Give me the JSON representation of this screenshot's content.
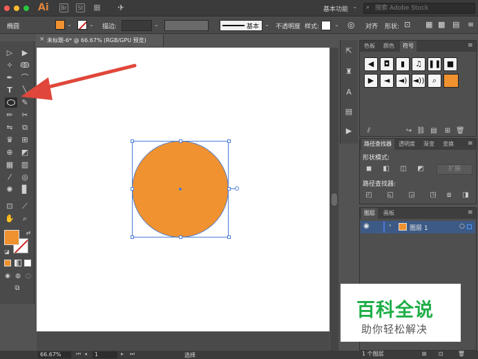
{
  "titlebar": {
    "app_logo": "Ai",
    "bridge_icon": "Br",
    "stock_icon": "St",
    "workspace": "基本功能",
    "search_placeholder": "搜索 Adobe Stock",
    "colors": {
      "close": "#fc5f57",
      "minimize": "#fdbc2e",
      "zoom": "#28c940"
    }
  },
  "controlbar": {
    "object_type": "椭圆",
    "stroke_label": "描边:",
    "brush_preset": "基本",
    "opacity_label": "不透明度",
    "style_label": "样式:",
    "align_label": "对齐",
    "shape_label": "形状:",
    "fill_color": "#f0922f"
  },
  "document": {
    "tab_title": "未标题-6* @ 66.67% (RGB/GPU 预览)",
    "close_icon": "×"
  },
  "panels": {
    "swatches": {
      "tabs": [
        "色板",
        "颜色",
        "符号"
      ]
    },
    "pathfinder": {
      "tabs": [
        "路径查找器",
        "透明度",
        "渐变",
        "变换"
      ],
      "shape_modes_label": "形状模式:",
      "expand_button": "扩展",
      "pathfinders_label": "路径查找器:"
    },
    "layers": {
      "tabs": [
        "图层",
        "画板"
      ],
      "layer_name": "图层 1",
      "layer_count": "1 个图层"
    }
  },
  "statusbar": {
    "zoom": "66.67%",
    "page": "1",
    "tool_status": "选择"
  },
  "watermark": {
    "title": "百科全说",
    "subtitle": "助你轻松解决"
  },
  "artwork": {
    "circle_fill": "#f0922f",
    "selection_color": "#4b7bd8",
    "annotation_arrow_color": "#e0473a"
  }
}
